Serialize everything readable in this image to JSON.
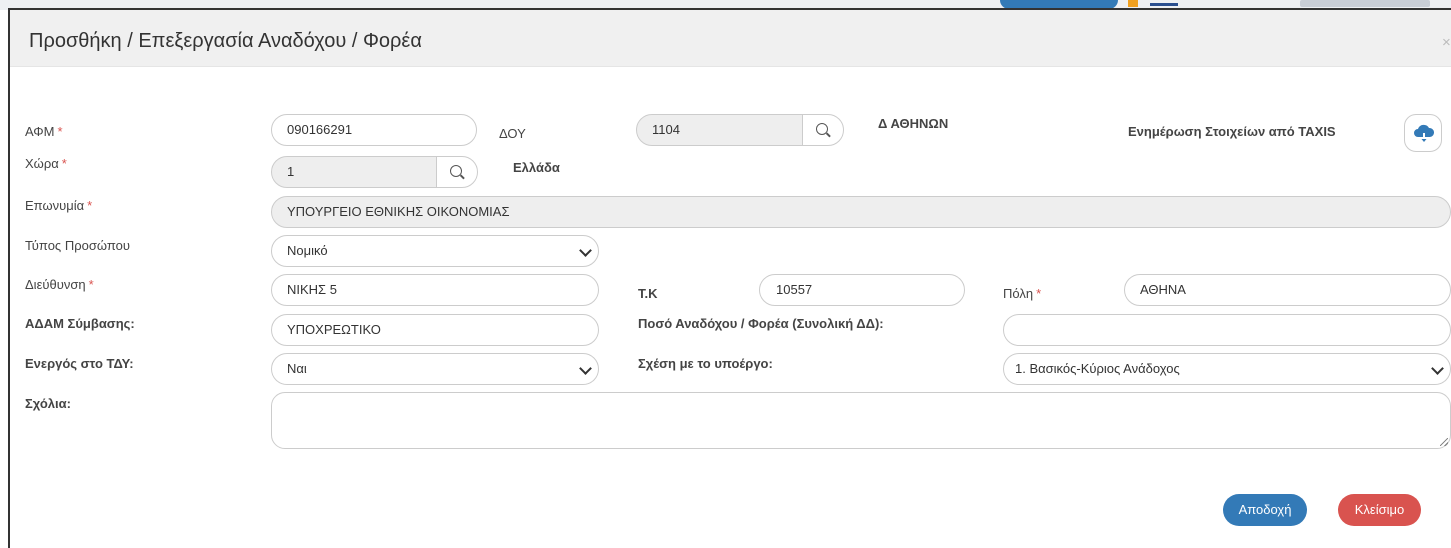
{
  "modal": {
    "title": "Προσθήκη / Επεξεργασία Αναδόχου / Φορέα",
    "close_symbol": "×"
  },
  "fields": {
    "afm": {
      "label": "ΑΦΜ",
      "required": "*",
      "value": "090166291"
    },
    "doy": {
      "label": "ΔΟΥ",
      "value": "1104",
      "description": "Δ ΑΘΗΝΩΝ"
    },
    "taxis_update": {
      "label": "Ενημέρωση Στοιχείων από TAXIS",
      "icon": "cloud-download-icon"
    },
    "country": {
      "label": "Χώρα",
      "required": "*",
      "value": "1",
      "description": "Ελλάδα"
    },
    "name": {
      "label": "Επωνυμία",
      "required": "*",
      "value": "ΥΠΟΥΡΓΕΙΟ ΕΘΝΙΚΗΣ ΟΙΚΟΝΟΜΙΑΣ"
    },
    "person_type": {
      "label": "Τύπος Προσώπου",
      "value": "Νομικό"
    },
    "address": {
      "label": "Διεύθυνση",
      "required": "*",
      "value": "ΝΙΚΗΣ 5"
    },
    "postal_code": {
      "label": "Τ.Κ",
      "value": "10557"
    },
    "city": {
      "label": "Πόλη",
      "required": "*",
      "value": "ΑΘΗΝΑ"
    },
    "adam": {
      "label": "ΑΔΑΜ Σύμβασης:",
      "value": "ΥΠΟΧΡΕΩΤΙΚΟ"
    },
    "amount": {
      "label": "Ποσό Αναδόχου / Φορέα (Συνολική ΔΔ):",
      "value": ""
    },
    "active": {
      "label": "Ενεργός στο ΤΔΥ:",
      "value": "Ναι"
    },
    "relation": {
      "label": "Σχέση με το υποέργο:",
      "value": "1. Βασικός-Κύριος Ανάδοχος"
    },
    "comments": {
      "label": "Σχόλια:",
      "value": ""
    }
  },
  "buttons": {
    "accept": "Αποδοχή",
    "close": "Κλείσιμο"
  },
  "colors": {
    "primary": "#337ab7",
    "danger": "#d9534f",
    "required": "#d9534f"
  }
}
